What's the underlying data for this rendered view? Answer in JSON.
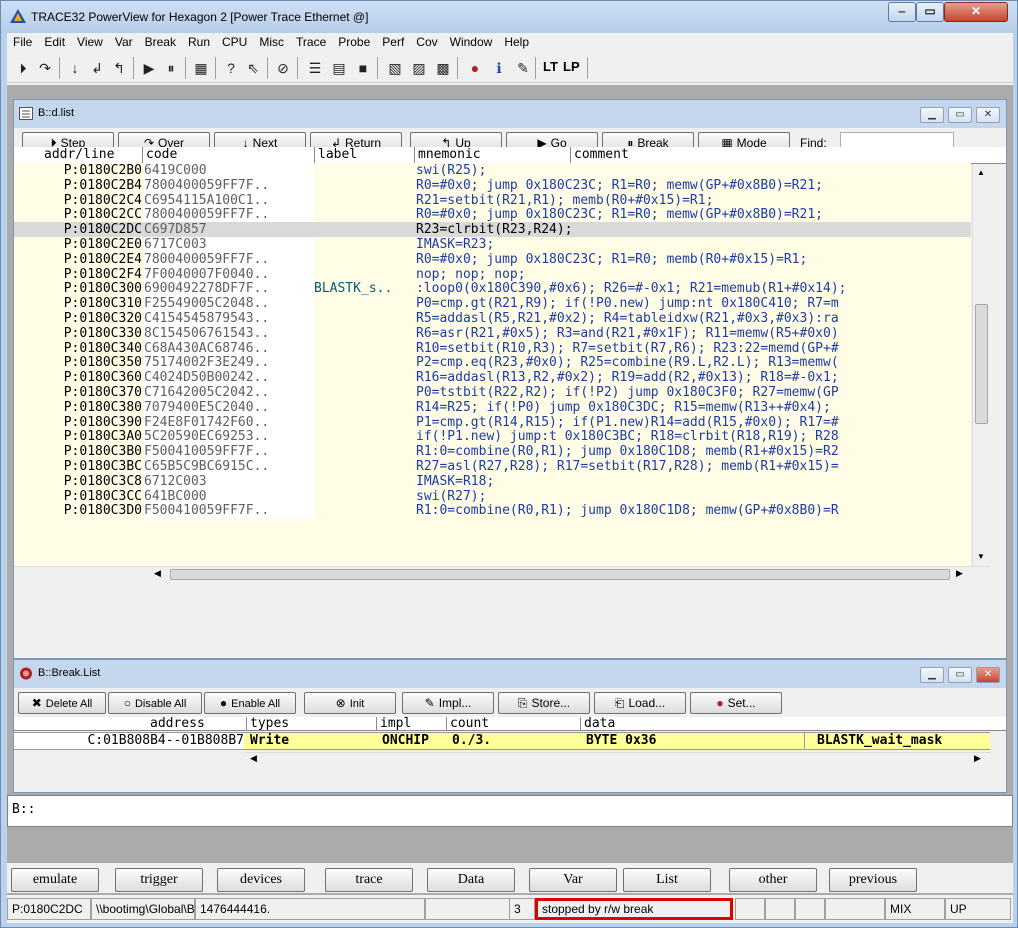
{
  "window": {
    "title": "TRACE32 PowerView for Hexagon 2 [Power Trace Ethernet @]"
  },
  "menu": [
    "File",
    "Edit",
    "View",
    "Var",
    "Break",
    "Run",
    "CPU",
    "Misc",
    "Trace",
    "Probe",
    "Perf",
    "Cov",
    "Window",
    "Help"
  ],
  "toolbar": {
    "lt_label": "LT",
    "lp_label": "LP"
  },
  "list_window": {
    "title": "B::d.list",
    "buttons": {
      "step": "Step",
      "over": "Over",
      "next": "Next",
      "return": "Return",
      "up": "Up",
      "go": "Go",
      "break": "Break",
      "mode": "Mode",
      "find": "Find:"
    },
    "columns": [
      "addr/line",
      "code",
      "label",
      "mnemonic",
      "comment"
    ],
    "rows": [
      {
        "addr": "P:0180C2B0",
        "code": "6419C000",
        "label": "",
        "mnemonic": "swi(R25);"
      },
      {
        "addr": "P:0180C2B4",
        "code": "7800400059FF7F..",
        "label": "",
        "mnemonic": "R0=#0x0; jump 0x180C23C; R1=R0; memw(GP+#0x8B0)=R21;"
      },
      {
        "addr": "P:0180C2C4",
        "code": "C6954115A100C1..",
        "label": "",
        "mnemonic": "R21=setbit(R21,R1); memb(R0+#0x15)=R1;"
      },
      {
        "addr": "P:0180C2CC",
        "code": "7800400059FF7F..",
        "label": "",
        "mnemonic": "R0=#0x0; jump 0x180C23C; R1=R0; memw(GP+#0x8B0)=R21;"
      },
      {
        "addr": "P:0180C2DC",
        "code": "C697D857",
        "label": "",
        "mnemonic": "R23=clrbit(R23,R24);",
        "selected": true
      },
      {
        "addr": "P:0180C2E0",
        "code": "6717C003",
        "label": "",
        "mnemonic": "IMASK=R23;"
      },
      {
        "addr": "P:0180C2E4",
        "code": "7800400059FF7F..",
        "label": "",
        "mnemonic": "R0=#0x0; jump 0x180C23C; R1=R0; memb(R0+#0x15)=R1;"
      },
      {
        "addr": "P:0180C2F4",
        "code": "7F0040007F0040..",
        "label": "",
        "mnemonic": "nop; nop; nop;"
      },
      {
        "addr": "P:0180C300",
        "code": "6900492278DF7F..",
        "label": "BLASTK_s..",
        "mnemonic": ":loop0(0x180C390,#0x6); R26=#-0x1; R21=memub(R1+#0x14);"
      },
      {
        "addr": "P:0180C310",
        "code": "F25549005C2048..",
        "label": "",
        "mnemonic": "P0=cmp.gt(R21,R9); if(!P0.new) jump:nt 0x180C410; R7=m"
      },
      {
        "addr": "P:0180C320",
        "code": "C4154545879543..",
        "label": "",
        "mnemonic": "R5=addasl(R5,R21,#0x2); R4=tableidxw(R21,#0x3,#0x3):ra"
      },
      {
        "addr": "P:0180C330",
        "code": "8C154506761543..",
        "label": "",
        "mnemonic": "R6=asr(R21,#0x5); R3=and(R21,#0x1F); R11=memw(R5+#0x0)"
      },
      {
        "addr": "P:0180C340",
        "code": "C68A430AC68746..",
        "label": "",
        "mnemonic": "R10=setbit(R10,R3); R7=setbit(R7,R6); R23:22=memd(GP+#"
      },
      {
        "addr": "P:0180C350",
        "code": "75174002F3E249..",
        "label": "",
        "mnemonic": "P2=cmp.eq(R23,#0x0); R25=combine(R9.L,R2.L); R13=memw("
      },
      {
        "addr": "P:0180C360",
        "code": "C4024D50B00242..",
        "label": "",
        "mnemonic": "R16=addasl(R13,R2,#0x2); R19=add(R2,#0x13); R18=#-0x1;"
      },
      {
        "addr": "P:0180C370",
        "code": "C71642005C2042..",
        "label": "",
        "mnemonic": "P0=tstbit(R22,R2); if(!P2) jump 0x180C3F0; R27=memw(GP"
      },
      {
        "addr": "P:0180C380",
        "code": "7079400E5C2040..",
        "label": "",
        "mnemonic": "R14=R25; if(!P0) jump 0x180C3DC; R15=memw(R13++#0x4);"
      },
      {
        "addr": "P:0180C390",
        "code": "F24E8F01742F60..",
        "label": "",
        "mnemonic": "P1=cmp.gt(R14,R15); if(P1.new)R14=add(R15,#0x0); R17=#"
      },
      {
        "addr": "P:0180C3A0",
        "code": "5C20590EC69253..",
        "label": "",
        "mnemonic": "if(!P1.new) jump:t 0x180C3BC; R18=clrbit(R18,R19); R28"
      },
      {
        "addr": "P:0180C3B0",
        "code": "F500410059FF7F..",
        "label": "",
        "mnemonic": "R1:0=combine(R0,R1); jump 0x180C1D8; memb(R1+#0x15)=R2"
      },
      {
        "addr": "P:0180C3BC",
        "code": "C65B5C9BC6915C..",
        "label": "",
        "mnemonic": "R27=asl(R27,R28); R17=setbit(R17,R28); memb(R1+#0x15)="
      },
      {
        "addr": "P:0180C3C8",
        "code": "6712C003",
        "label": "",
        "mnemonic": "IMASK=R18;"
      },
      {
        "addr": "P:0180C3CC",
        "code": "641BC000",
        "label": "",
        "mnemonic": "swi(R27);"
      },
      {
        "addr": "P:0180C3D0",
        "code": "F500410059FF7F..",
        "label": "",
        "mnemonic": "R1:0=combine(R0,R1); jump 0x180C1D8; memw(GP+#0x8B0)=R"
      }
    ]
  },
  "break_window": {
    "title": "B::Break.List",
    "buttons": {
      "delete_all": "Delete All",
      "disable_all": "Disable All",
      "enable_all": "Enable All",
      "init": "Init",
      "impl": "Impl...",
      "store": "Store...",
      "load": "Load...",
      "set": "Set..."
    },
    "columns": [
      "address",
      "types",
      "impl",
      "count",
      "data"
    ],
    "row": {
      "address": "C:01B808B4--01B808B7",
      "types": "Write",
      "impl": "ONCHIP",
      "count": "0./3.",
      "data": "BYTE 0x36",
      "symbol": "BLASTK_wait_mask"
    }
  },
  "command": {
    "prompt": "B::"
  },
  "softkeys": [
    "emulate",
    "trigger",
    "devices",
    "trace",
    "Data",
    "Var",
    "List",
    "other",
    "previous"
  ],
  "status": {
    "address": "P:0180C2DC",
    "path": "\\\\bootimg\\Global\\BLA",
    "value": "1476444416.",
    "count": "3",
    "state": "stopped by r/w break",
    "mode": "MIX",
    "updown": "UP"
  },
  "colors": {
    "highlight_box": "#e00000",
    "list_bg": "#fffde6",
    "break_row_bg": "#ffff99"
  }
}
